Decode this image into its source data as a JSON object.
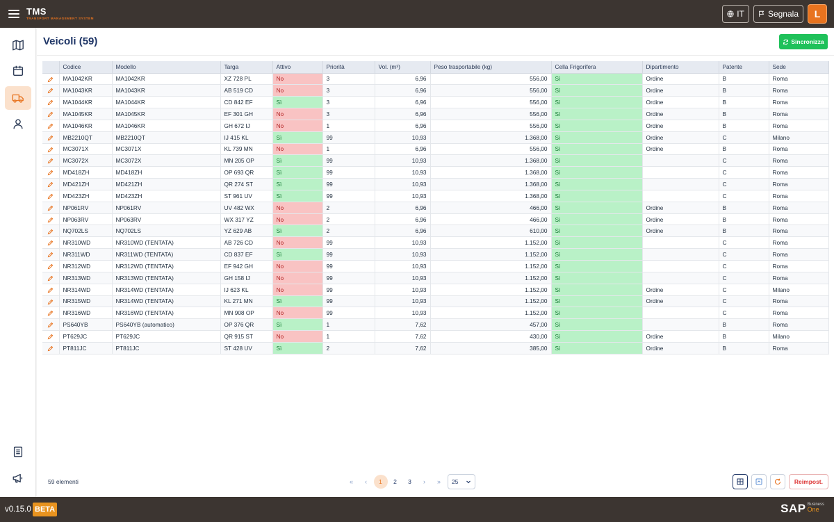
{
  "app": {
    "title": "TMS",
    "subtitle": "TRANSPORT MANAGEMENT SYSTEM"
  },
  "topbar": {
    "language": "IT",
    "report_label": "Segnala",
    "avatar_initial": "L"
  },
  "page": {
    "title": "Veicoli (59)",
    "sync_label": "Sincronizza"
  },
  "table": {
    "columns": [
      "Codice",
      "Modello",
      "Targa",
      "Attivo",
      "Priorità",
      "Vol. (m³)",
      "Peso trasportabile (kg)",
      "Cella Frigorifera",
      "Dipartimento",
      "Patente",
      "Sede"
    ],
    "rows": [
      [
        "MA1042KR",
        "MA1042KR",
        "XZ 728 PL",
        "No",
        "3",
        "6,96",
        "556,00",
        "Sì",
        "Ordine",
        "B",
        "Roma"
      ],
      [
        "MA1043KR",
        "MA1043KR",
        "AB 519 CD",
        "No",
        "3",
        "6,96",
        "556,00",
        "Sì",
        "Ordine",
        "B",
        "Roma"
      ],
      [
        "MA1044KR",
        "MA1044KR",
        "CD 842 EF",
        "Sì",
        "3",
        "6,96",
        "556,00",
        "Sì",
        "Ordine",
        "B",
        "Roma"
      ],
      [
        "MA1045KR",
        "MA1045KR",
        "EF 301 GH",
        "No",
        "3",
        "6,96",
        "556,00",
        "Sì",
        "Ordine",
        "B",
        "Roma"
      ],
      [
        "MA1046KR",
        "MA1046KR",
        "GH 672 IJ",
        "No",
        "1",
        "6,96",
        "556,00",
        "Sì",
        "Ordine",
        "B",
        "Roma"
      ],
      [
        "MB2210QT",
        "MB2210QT",
        "IJ 415 KL",
        "Sì",
        "99",
        "10,93",
        "1.368,00",
        "Sì",
        "Ordine",
        "C",
        "Milano"
      ],
      [
        "MC3071X",
        "MC3071X",
        "KL 739 MN",
        "No",
        "1",
        "6,96",
        "556,00",
        "Sì",
        "Ordine",
        "B",
        "Roma"
      ],
      [
        "MC3072X",
        "MC3072X",
        "MN 205 OP",
        "Sì",
        "99",
        "10,93",
        "1.368,00",
        "Sì",
        "",
        "C",
        "Roma"
      ],
      [
        "MD418ZH",
        "MD418ZH",
        "OP 693 QR",
        "Sì",
        "99",
        "10,93",
        "1.368,00",
        "Sì",
        "",
        "C",
        "Roma"
      ],
      [
        "MD421ZH",
        "MD421ZH",
        "QR 274 ST",
        "Sì",
        "99",
        "10,93",
        "1.368,00",
        "Sì",
        "",
        "C",
        "Roma"
      ],
      [
        "MD423ZH",
        "MD423ZH",
        "ST 961 UV",
        "Sì",
        "99",
        "10,93",
        "1.368,00",
        "Sì",
        "",
        "C",
        "Roma"
      ],
      [
        "NP061RV",
        "NP061RV",
        "UV 482 WX",
        "No",
        "2",
        "6,96",
        "466,00",
        "Sì",
        "Ordine",
        "B",
        "Roma"
      ],
      [
        "NP063RV",
        "NP063RV",
        "WX 317 YZ",
        "No",
        "2",
        "6,96",
        "466,00",
        "Sì",
        "Ordine",
        "B",
        "Roma"
      ],
      [
        "NQ702LS",
        "NQ702LS",
        "YZ 629 AB",
        "Sì",
        "2",
        "6,96",
        "610,00",
        "Sì",
        "Ordine",
        "B",
        "Roma"
      ],
      [
        "NR310WD",
        "NR310WD (TENTATA)",
        "AB 726 CD",
        "No",
        "99",
        "10,93",
        "1.152,00",
        "Sì",
        "",
        "C",
        "Roma"
      ],
      [
        "NR311WD",
        "NR311WD (TENTATA)",
        "CD 837 EF",
        "Sì",
        "99",
        "10,93",
        "1.152,00",
        "Sì",
        "",
        "C",
        "Roma"
      ],
      [
        "NR312WD",
        "NR312WD (TENTATA)",
        "EF 942 GH",
        "No",
        "99",
        "10,93",
        "1.152,00",
        "Sì",
        "",
        "C",
        "Roma"
      ],
      [
        "NR313WD",
        "NR313WD (TENTATA)",
        "GH 158 IJ",
        "No",
        "99",
        "10,93",
        "1.152,00",
        "Sì",
        "",
        "C",
        "Roma"
      ],
      [
        "NR314WD",
        "NR314WD (TENTATA)",
        "IJ 623 KL",
        "No",
        "99",
        "10,93",
        "1.152,00",
        "Sì",
        "Ordine",
        "C",
        "Milano"
      ],
      [
        "NR315WD",
        "NR314WD (TENTATA)",
        "KL 271 MN",
        "Sì",
        "99",
        "10,93",
        "1.152,00",
        "Sì",
        "Ordine",
        "C",
        "Roma"
      ],
      [
        "NR316WD",
        "NR316WD (TENTATA)",
        "MN 908 OP",
        "No",
        "99",
        "10,93",
        "1.152,00",
        "Sì",
        "",
        "C",
        "Roma"
      ],
      [
        "PS640YB",
        "PS640YB (automatico)",
        "OP 376 QR",
        "Sì",
        "1",
        "7,62",
        "457,00",
        "Sì",
        "",
        "B",
        "Roma"
      ],
      [
        "PT629JC",
        "PT629JC",
        "QR 915 ST",
        "No",
        "1",
        "7,62",
        "430,00",
        "Sì",
        "Ordine",
        "B",
        "Milano"
      ],
      [
        "PT811JC",
        "PT811JC",
        "ST 428 UV",
        "Sì",
        "2",
        "7,62",
        "385,00",
        "Sì",
        "Ordine",
        "B",
        "Roma"
      ]
    ]
  },
  "footer": {
    "count_label": "59 elementi",
    "pages": [
      "1",
      "2",
      "3"
    ],
    "current_page": "1",
    "page_size": "25",
    "reset_label": "Reimpost."
  },
  "bottombar": {
    "version": "v0.15.0",
    "badge": "BETA",
    "brand": "SAP",
    "brand_sub1": "Business",
    "brand_sub2": "One"
  },
  "colors": {
    "accent": "#e8731f",
    "title": "#1e3566",
    "success": "#1fc15a",
    "no_bg": "#f9c3c3",
    "yes_bg": "#b9f1c7",
    "bar": "#3c3531"
  },
  "icons": [
    "menu-icon",
    "globe-icon",
    "flag-icon",
    "map-icon",
    "calendar-icon",
    "truck-icon",
    "user-icon",
    "document-icon",
    "megaphone-icon",
    "refresh-icon",
    "edit-icon",
    "grid-icon",
    "export-icon",
    "reload-icon"
  ]
}
